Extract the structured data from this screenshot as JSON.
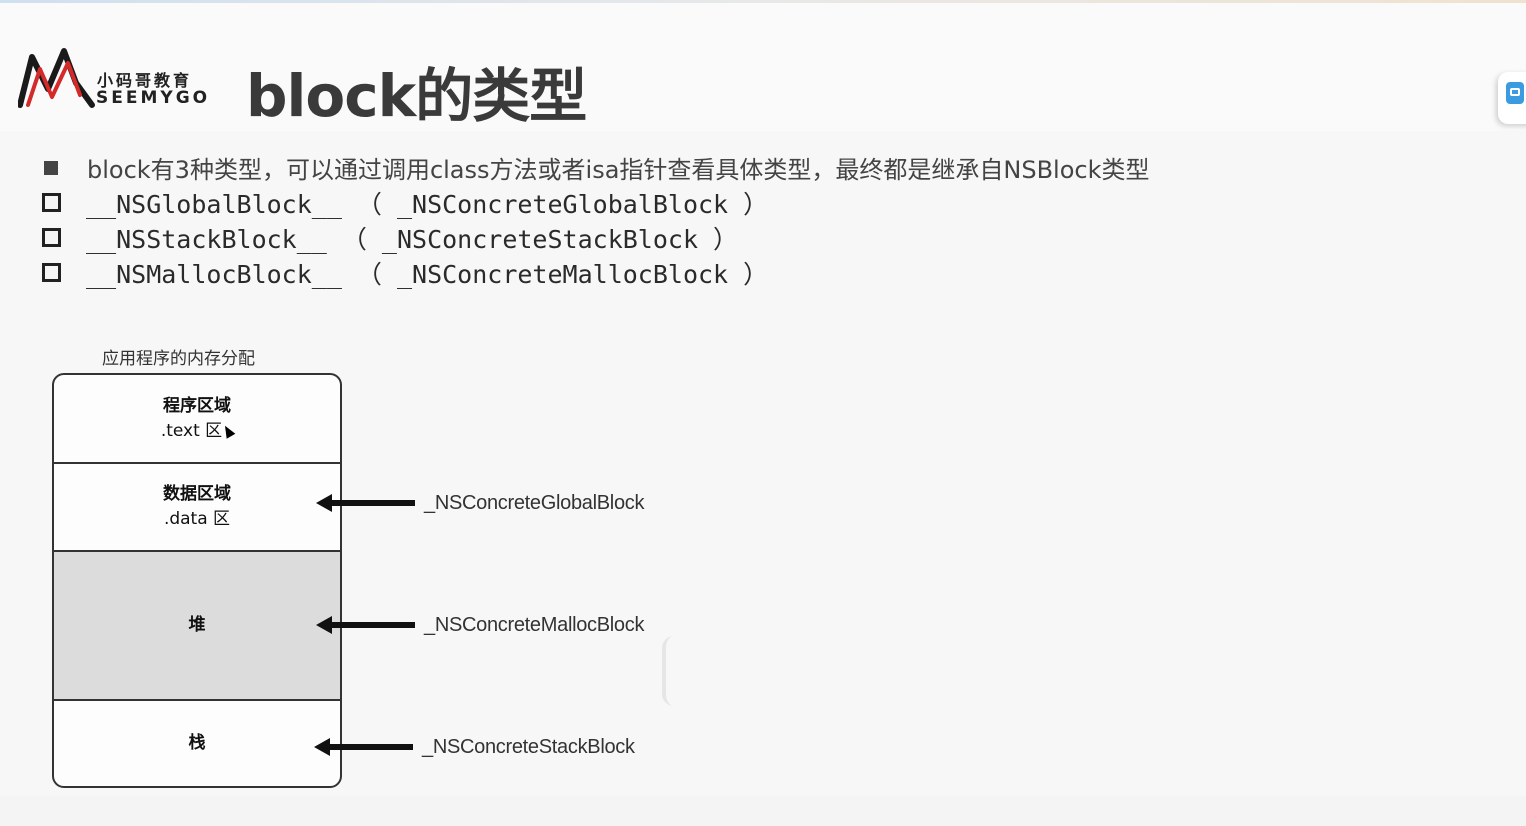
{
  "slide": {
    "title": "block的类型",
    "logo": {
      "cn": "小码哥教育",
      "en": "SEEMYGO"
    },
    "bullets": [
      {
        "style": "filled",
        "text": "block有3种类型，可以通过调用class方法或者isa指针查看具体类型，最终都是继承自NSBlock类型"
      },
      {
        "style": "hollow",
        "text": "__NSGlobalBlock__ （ _NSConcreteGlobalBlock ）"
      },
      {
        "style": "hollow",
        "text": "__NSStackBlock__ （ _NSConcreteStackBlock ）"
      },
      {
        "style": "hollow",
        "text": "__NSMallocBlock__ （ _NSConcreteMallocBlock ）"
      }
    ],
    "diagram": {
      "caption": "应用程序的内存分配",
      "segments": {
        "text": {
          "title": "程序区域",
          "sub": ".text 区"
        },
        "data": {
          "title": "数据区域",
          "sub": ".data 区"
        },
        "heap": {
          "title": "堆"
        },
        "stack": {
          "title": "栈"
        }
      },
      "arrows": {
        "global": "_NSConcreteGlobalBlock",
        "malloc": "_NSConcreteMallocBlock",
        "stack": "_NSConcreteStackBlock"
      }
    },
    "colors": {
      "heap_fill": "#dcdcdc",
      "title_text": "#3a3a3a",
      "logo_red": "#d42a2a"
    },
    "icons": {
      "side_widget": "screen-share-icon",
      "cursor": "mouse-pointer-icon"
    }
  }
}
